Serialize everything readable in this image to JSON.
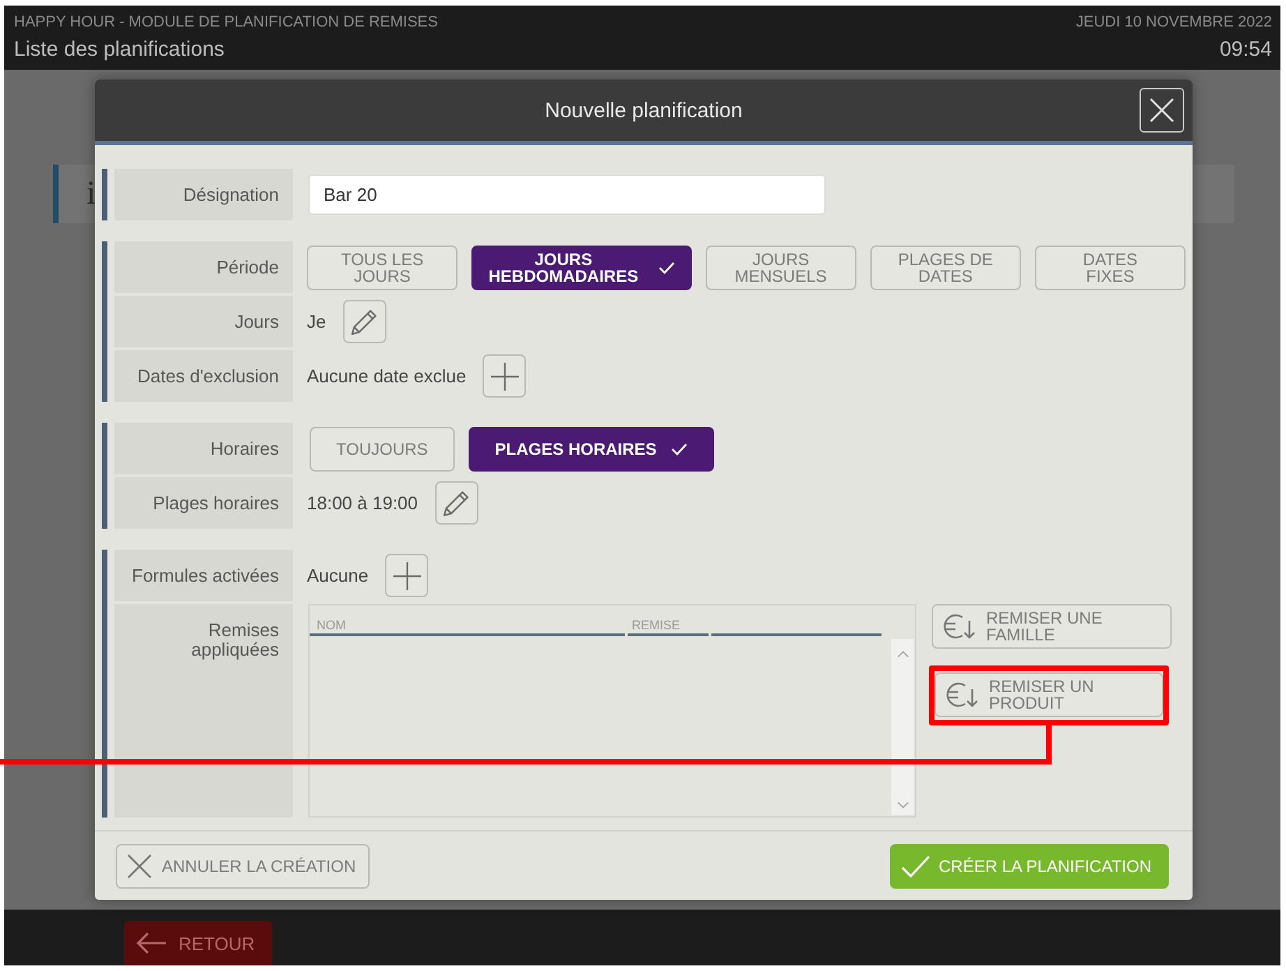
{
  "header": {
    "app_title": "HAPPY HOUR - MODULE DE PLANIFICATION DE REMISES",
    "page_title": "Liste des planifications",
    "date": "JEUDI 10 NOVEMBRE 2022",
    "time": "09:54"
  },
  "background_card": {
    "text": "i"
  },
  "dialog": {
    "title": "Nouvelle planification",
    "sections": [
      {
        "rows": [
          {
            "kind": "input",
            "label": "Désignation",
            "value": "Bar 20"
          }
        ]
      },
      {
        "rows": [
          {
            "kind": "segmented",
            "label": "Période",
            "options": [
              {
                "label": "TOUS LES JOURS",
                "selected": false
              },
              {
                "label": "JOURS HEBDOMADAIRES",
                "selected": true
              },
              {
                "label": "JOURS MENSUELS",
                "selected": false
              },
              {
                "label": "PLAGES DE DATES",
                "selected": false
              },
              {
                "label": "DATES FIXES",
                "selected": false
              }
            ]
          },
          {
            "kind": "edit",
            "label": "Jours",
            "value": "Je"
          },
          {
            "kind": "add",
            "label": "Dates d'exclusion",
            "value": "Aucune date exclue"
          }
        ]
      },
      {
        "rows": [
          {
            "kind": "toggle",
            "label": "Horaires",
            "options": [
              {
                "label": "TOUJOURS",
                "selected": false
              },
              {
                "label": "PLAGES HORAIRES",
                "selected": true
              }
            ]
          },
          {
            "kind": "edit",
            "label": "Plages horaires",
            "value": "18:00 à 19:00"
          }
        ]
      },
      {
        "rows": [
          {
            "kind": "add",
            "label": "Formules activées",
            "value": "Aucune"
          },
          {
            "kind": "table",
            "label": "Remises appliquées",
            "columns": [
              "NOM",
              "REMISE"
            ],
            "actions": [
              {
                "label": "REMISER UNE FAMILLE",
                "highlighted": false
              },
              {
                "label": "REMISER UN PRODUIT",
                "highlighted": true
              }
            ]
          }
        ]
      }
    ],
    "cancel_button": "ANNULER LA CRÉATION",
    "create_button": "CRÉER LA PLANIFICATION"
  },
  "back_button": "RETOUR"
}
